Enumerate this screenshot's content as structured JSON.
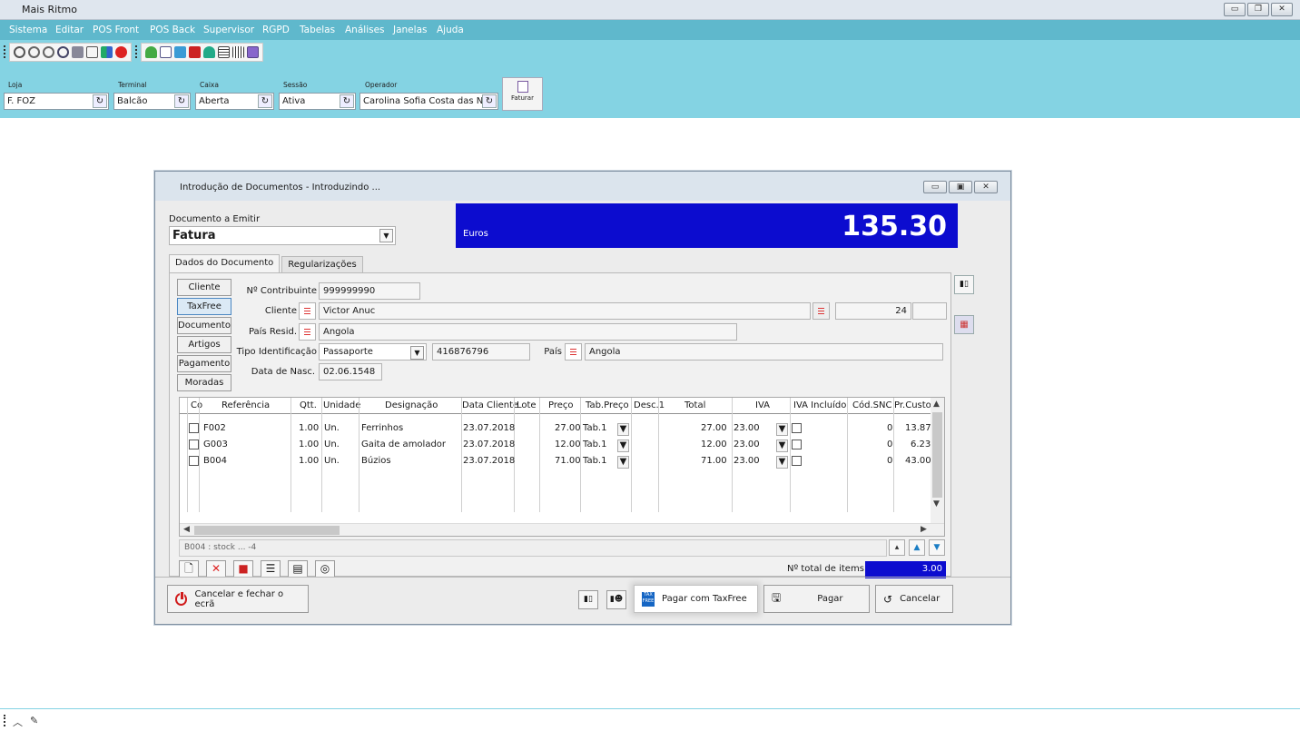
{
  "app": {
    "title": "Mais Ritmo"
  },
  "menu": [
    "Sistema",
    "Editar",
    "POS Front",
    "POS Back",
    "Supervisor",
    "RGPD",
    "Tabelas",
    "Análises",
    "Janelas",
    "Ajuda"
  ],
  "context": {
    "loja_label": "Loja",
    "loja": "F. FOZ",
    "terminal_label": "Terminal",
    "terminal": "Balcão",
    "caixa_label": "Caixa",
    "caixa": "Aberta",
    "sessao_label": "Sessão",
    "sessao": "Ativa",
    "operador_label": "Operador",
    "operador": "Carolina Sofia Costa das N",
    "faturar": "Faturar"
  },
  "dialog": {
    "title": "Introdução de Documentos - Introduzindo ...",
    "doc_label": "Documento a Emitir",
    "doc_value": "Fatura",
    "currency": "Euros",
    "total": "135.30",
    "tabs": [
      "Dados do Documento",
      "Regularizações"
    ],
    "side_buttons": [
      "Cliente",
      "TaxFree",
      "Documento",
      "Artigos",
      "Pagamento",
      "Moradas"
    ],
    "form": {
      "contribuinte_label": "Nº Contribuinte",
      "contribuinte": "999999990",
      "cliente_label": "Cliente",
      "cliente": "Victor Anuc",
      "cliente_num": "24",
      "pais_resid_label": "País Resid.",
      "pais_resid": "Angola",
      "tipo_id_label": "Tipo Identificação",
      "tipo_id": "Passaporte",
      "id_num": "416876796",
      "pais_label": "País",
      "pais": "Angola",
      "nasc_label": "Data de Nasc.",
      "nasc": "02.06.1548"
    },
    "grid": {
      "headers": [
        "Co",
        "Referência",
        "Qtt.",
        "Unidade",
        "Designação",
        "Data Cliente",
        "Lote",
        "Preço",
        "Tab.Preço",
        "Desc.1",
        "Total",
        "IVA",
        "IVA Incluído",
        "Cód.SNC",
        "Pr.Custo"
      ],
      "rows": [
        {
          "ref": "F002",
          "qtt": "1.00",
          "un": "Un.",
          "des": "Ferrinhos",
          "data": "23.07.2018",
          "preco": "27.00",
          "tab": "Tab.1",
          "total": "27.00",
          "iva": "23.00",
          "snc": "0",
          "custo": "13.87"
        },
        {
          "ref": "G003",
          "qtt": "1.00",
          "un": "Un.",
          "des": "Gaita de amolador",
          "data": "23.07.2018",
          "preco": "12.00",
          "tab": "Tab.1",
          "total": "12.00",
          "iva": "23.00",
          "snc": "0",
          "custo": "6.23"
        },
        {
          "ref": "B004",
          "qtt": "1.00",
          "un": "Un.",
          "des": "Búzios",
          "data": "23.07.2018",
          "preco": "71.00",
          "tab": "Tab.1",
          "total": "71.00",
          "iva": "23.00",
          "snc": "0",
          "custo": "43.00"
        }
      ]
    },
    "status": "B004 : stock ... -4",
    "total_items_label": "Nº total de items",
    "total_items": "3.00",
    "buttons": {
      "cancel_close": "Cancelar e fechar o ecrã",
      "pay_taxfree": "Pagar com TaxFree",
      "pay": "Pagar",
      "cancel": "Cancelar"
    }
  },
  "colors": {
    "menubar": "#5fb8cc",
    "toparea": "#84d3e3",
    "total_bg": "#0c0ccf"
  }
}
